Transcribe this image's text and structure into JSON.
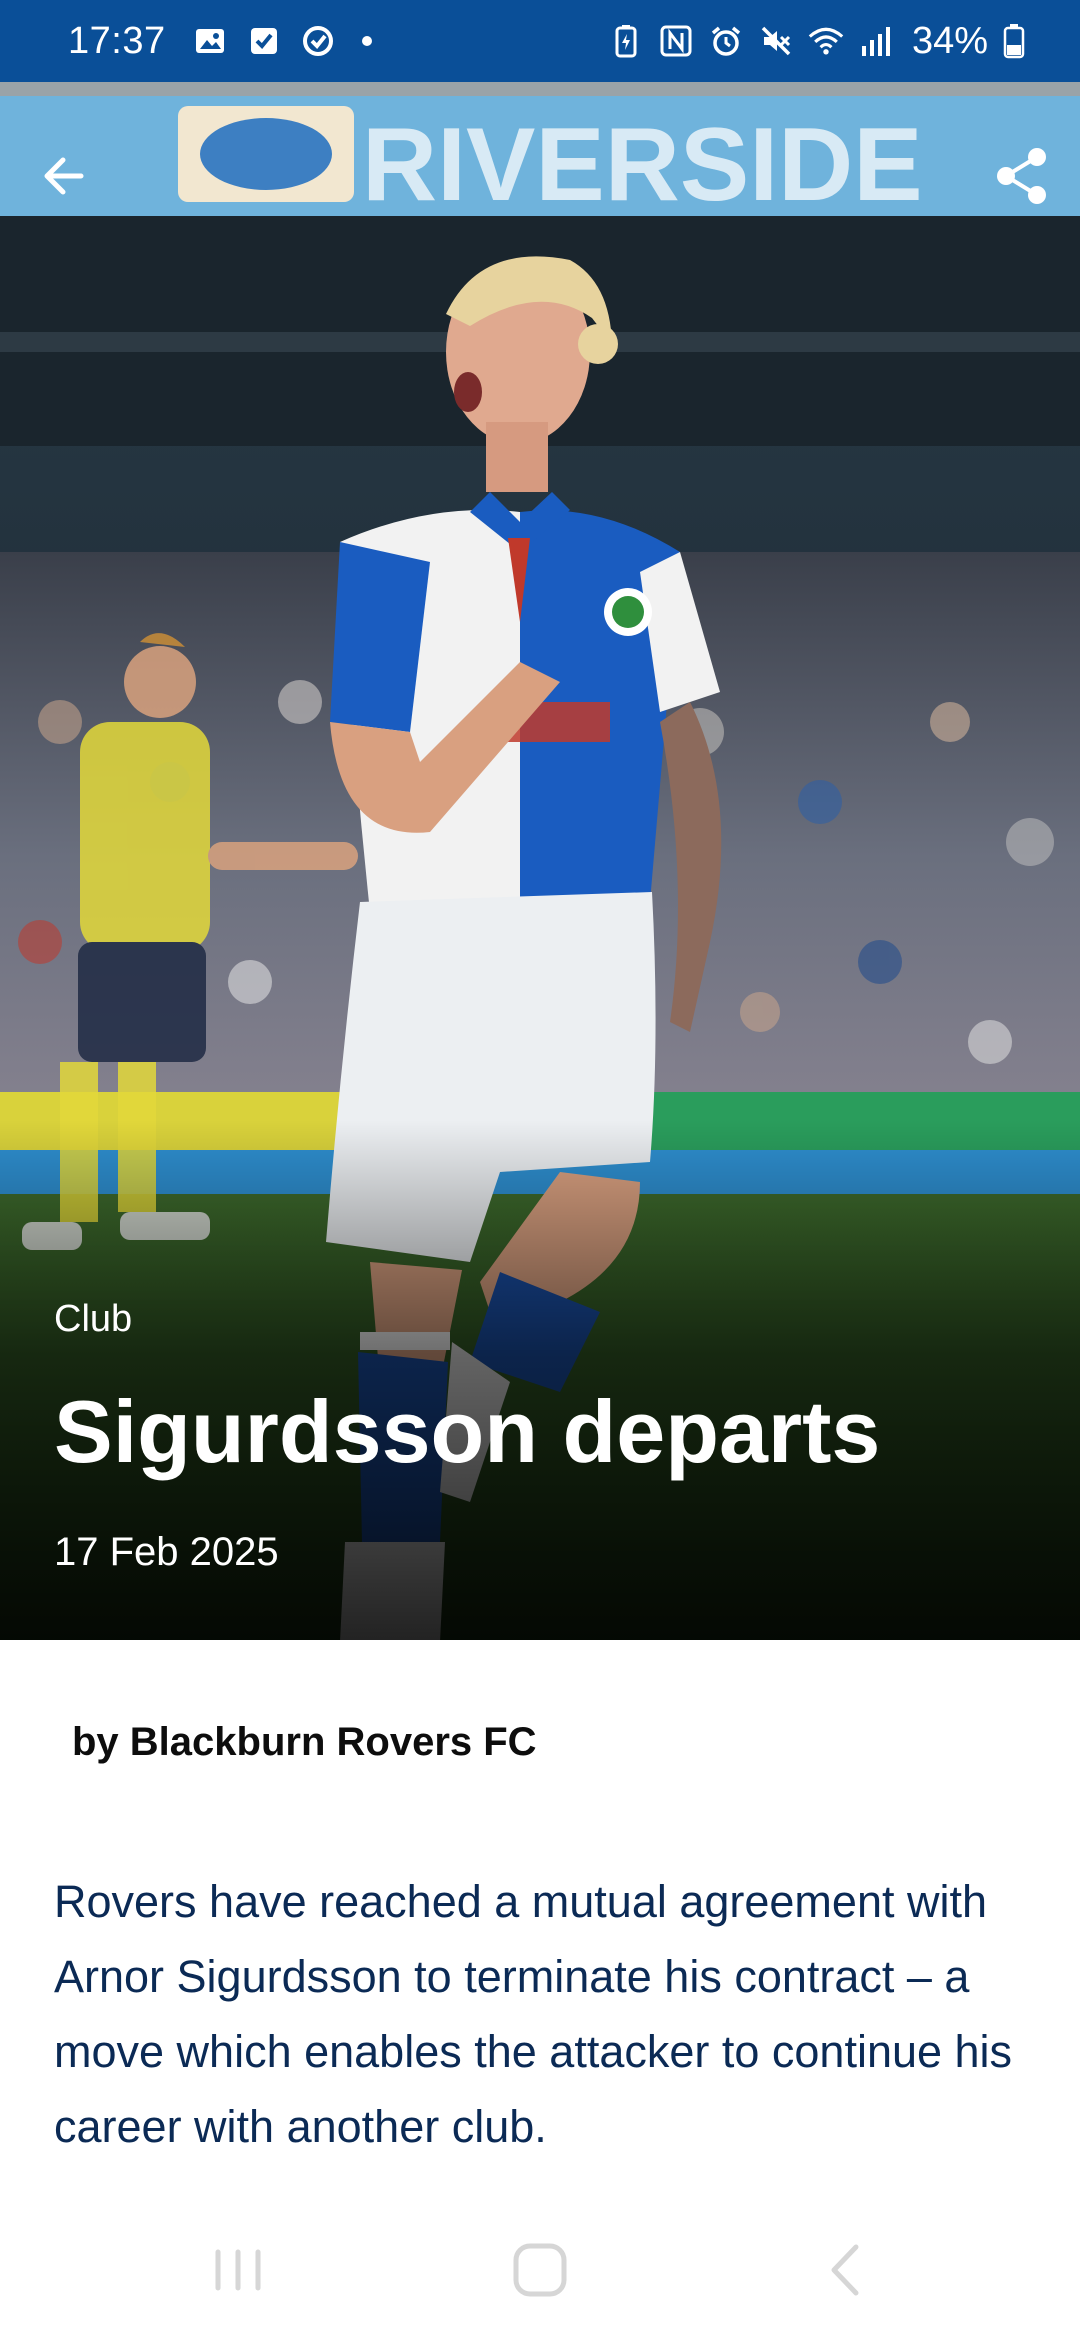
{
  "status_bar": {
    "time": "17:37",
    "battery_percent": "34%",
    "left_icons": [
      "gallery-icon",
      "checkbox-icon",
      "sync-icon",
      "dot-icon"
    ],
    "right_icons": [
      "battery-saver-icon",
      "nfc-icon",
      "alarm-icon",
      "mute-icon",
      "wifi-icon",
      "signal-icon",
      "battery-icon"
    ],
    "background_color": "#0a4f98"
  },
  "hero": {
    "background_image": "goal-celebration-photo",
    "category": "Club",
    "title": "Sigurdsson departs",
    "date": "17 Feb 2025",
    "stadium_banner_text": "RIVERSIDE",
    "back_icon": "arrow-left-icon",
    "share_icon": "share-icon"
  },
  "article": {
    "byline": "by Blackburn Rovers FC",
    "lead": "Rovers have reached a mutual agreement with Arnor Sigurdsson to terminate his contract – a move which enables the attacker to continue his career with another club.",
    "lead_color": "#0b2a55"
  },
  "nav_bar": {
    "buttons": [
      "recents-icon",
      "home-icon",
      "back-icon"
    ]
  }
}
